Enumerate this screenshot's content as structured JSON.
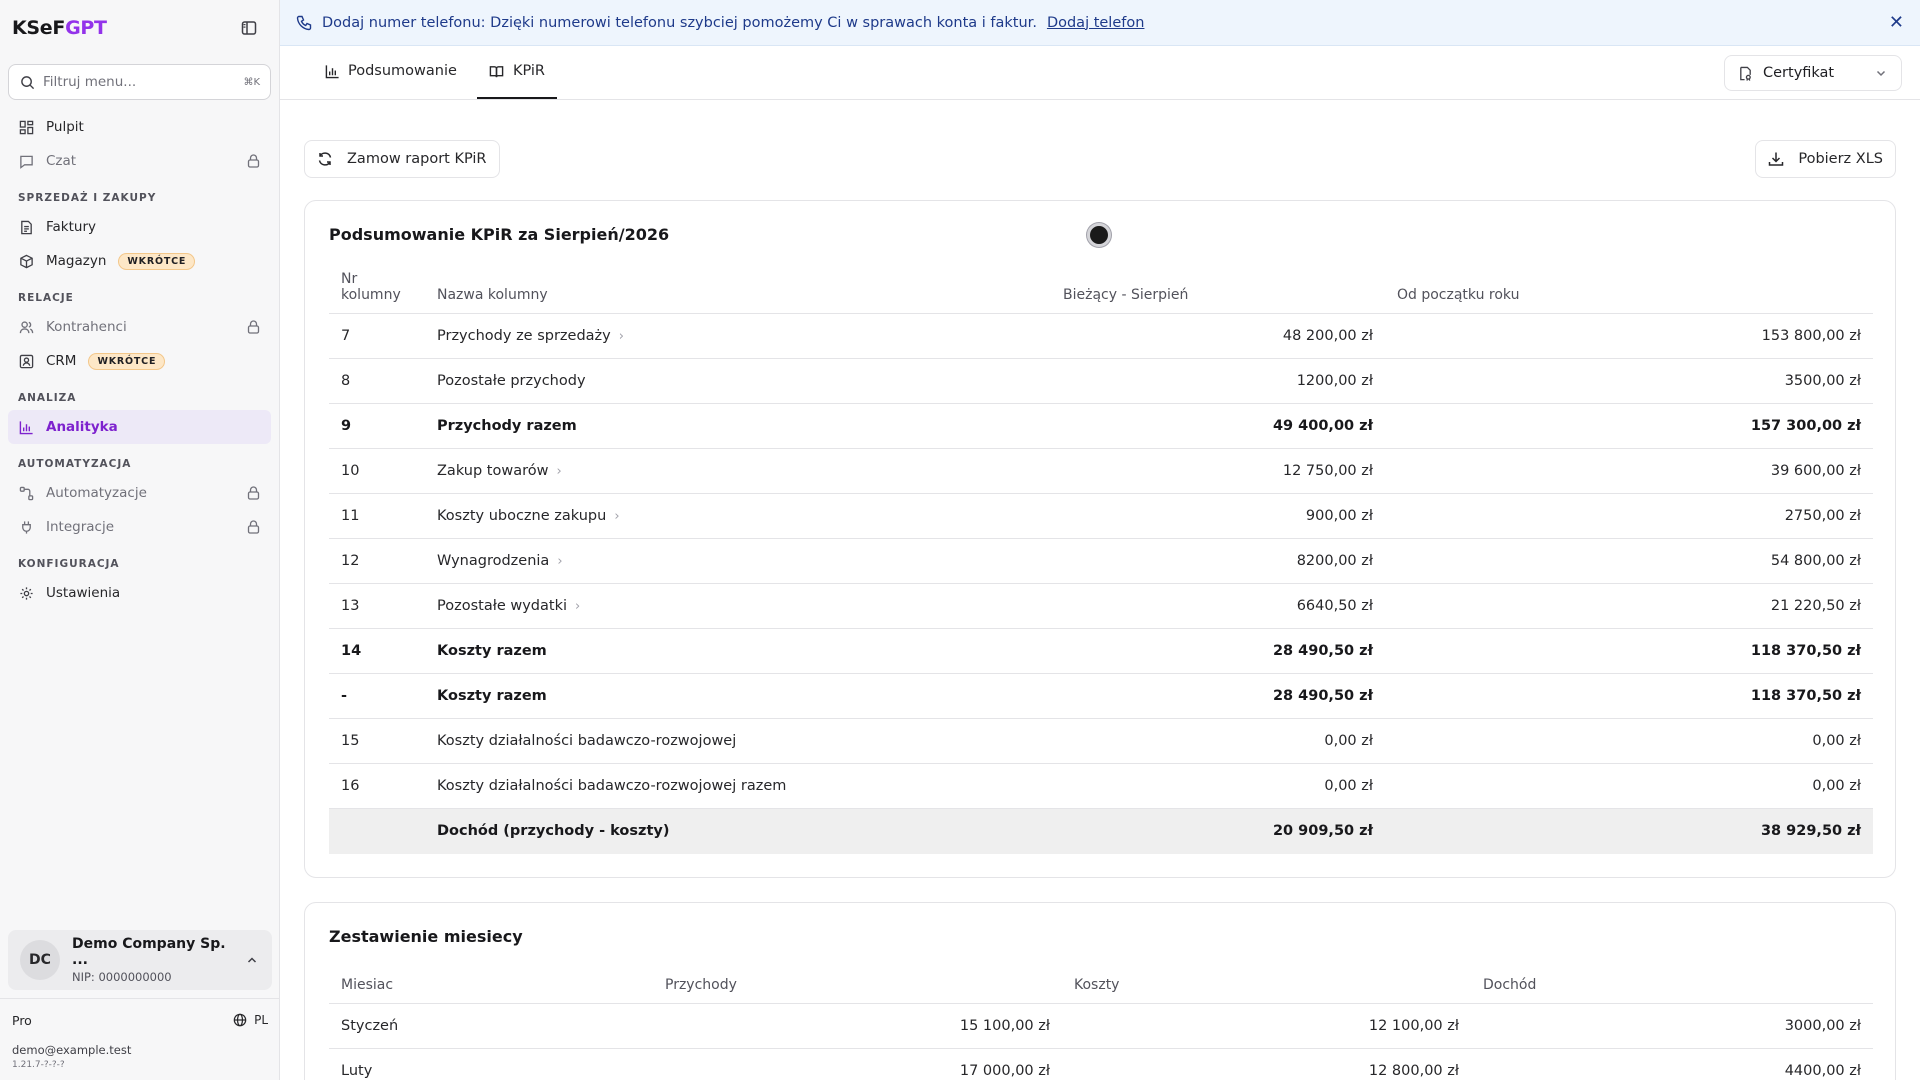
{
  "sidebar": {
    "logo_main": "KSeF",
    "logo_accent": "GPT",
    "search": {
      "placeholder": "Filtruj menu...",
      "shortcut": "⌘K"
    },
    "items_top": [
      {
        "label": "Pulpit",
        "icon": "dashboard-icon"
      },
      {
        "label": "Czat",
        "icon": "chat-icon",
        "locked": true
      }
    ],
    "sections": [
      {
        "title": "SPRZEDAŻ I ZAKUPY",
        "items": [
          {
            "label": "Faktury",
            "icon": "invoice-icon"
          },
          {
            "label": "Magazyn",
            "icon": "box-icon",
            "badge": "WKRÓTCE"
          }
        ]
      },
      {
        "title": "RELACJE",
        "items": [
          {
            "label": "Kontrahenci",
            "icon": "users-icon",
            "locked": true
          },
          {
            "label": "CRM",
            "icon": "contact-icon",
            "badge": "WKRÓTCE"
          }
        ]
      },
      {
        "title": "ANALIZA",
        "items": [
          {
            "label": "Analityka",
            "icon": "chart-icon",
            "active": true
          }
        ]
      },
      {
        "title": "AUTOMATYZACJA",
        "items": [
          {
            "label": "Automatyzacje",
            "icon": "workflow-icon",
            "locked": true
          },
          {
            "label": "Integracje",
            "icon": "plug-icon",
            "locked": true
          }
        ]
      },
      {
        "title": "KONFIGURACJA",
        "items": [
          {
            "label": "Ustawienia",
            "icon": "gear-icon"
          }
        ]
      }
    ],
    "company": {
      "initials": "DC",
      "name": "Demo Company Sp. ...",
      "nip": "NIP: 0000000000"
    },
    "plan": "Pro",
    "language": "PL",
    "email": "demo@example.test",
    "version": "1.21.7-?-?-?"
  },
  "banner": {
    "message": "Dodaj numer telefonu: Dzięki numerowi telefonu szybciej pomożemy Ci w sprawach konta i faktur.",
    "link": "Dodaj telefon"
  },
  "tabs": [
    {
      "label": "Podsumowanie",
      "active": false
    },
    {
      "label": "KPiR",
      "active": true
    }
  ],
  "certificate_select": "Certyfikat",
  "actions": {
    "order_report": "Zamow raport KPiR",
    "download_xls": "Pobierz XLS"
  },
  "summary": {
    "title": "Podsumowanie KPiR za Sierpień/2026",
    "headers": {
      "nr": "Nr kolumny",
      "name": "Nazwa kolumny",
      "current": "Bieżący - Sierpień",
      "ytd": "Od początku roku"
    },
    "rows": [
      {
        "nr": "7",
        "name": "Przychody ze sprzedaży",
        "current": "48 200,00 zł",
        "ytd": "153 800,00 zł",
        "expandable": true,
        "bold": false
      },
      {
        "nr": "8",
        "name": "Pozostałe przychody",
        "current": "1200,00 zł",
        "ytd": "3500,00 zł",
        "expandable": false,
        "bold": false
      },
      {
        "nr": "9",
        "name": "Przychody razem",
        "current": "49 400,00 zł",
        "ytd": "157 300,00 zł",
        "expandable": false,
        "bold": true
      },
      {
        "nr": "10",
        "name": "Zakup towarów",
        "current": "12 750,00 zł",
        "ytd": "39 600,00 zł",
        "expandable": true,
        "bold": false
      },
      {
        "nr": "11",
        "name": "Koszty uboczne zakupu",
        "current": "900,00 zł",
        "ytd": "2750,00 zł",
        "expandable": true,
        "bold": false
      },
      {
        "nr": "12",
        "name": "Wynagrodzenia",
        "current": "8200,00 zł",
        "ytd": "54 800,00 zł",
        "expandable": true,
        "bold": false
      },
      {
        "nr": "13",
        "name": "Pozostałe wydatki",
        "current": "6640,50 zł",
        "ytd": "21 220,50 zł",
        "expandable": true,
        "bold": false
      },
      {
        "nr": "14",
        "name": "Koszty razem",
        "current": "28 490,50 zł",
        "ytd": "118 370,50 zł",
        "expandable": false,
        "bold": true
      },
      {
        "nr": "-",
        "name": "Koszty razem",
        "current": "28 490,50 zł",
        "ytd": "118 370,50 zł",
        "expandable": false,
        "bold": true
      },
      {
        "nr": "15",
        "name": "Koszty działalności badawczo-rozwojowej",
        "current": "0,00 zł",
        "ytd": "0,00 zł",
        "expandable": false,
        "bold": false
      },
      {
        "nr": "16",
        "name": "Koszty działalności badawczo-rozwojowej razem",
        "current": "0,00 zł",
        "ytd": "0,00 zł",
        "expandable": false,
        "bold": false
      }
    ],
    "total": {
      "nr": "",
      "name": "Dochód (przychody - koszty)",
      "current": "20 909,50 zł",
      "ytd": "38 929,50 zł"
    }
  },
  "monthly": {
    "title": "Zestawienie miesiecy",
    "headers": {
      "month": "Miesiac",
      "income": "Przychody",
      "costs": "Koszty",
      "profit": "Dochód"
    },
    "rows": [
      {
        "month": "Styczeń",
        "income": "15 100,00 zł",
        "costs": "12 100,00 zł",
        "profit": "3000,00 zł"
      },
      {
        "month": "Luty",
        "income": "17 000,00 zł",
        "costs": "12 800,00 zł",
        "profit": "4400,00 zł"
      }
    ]
  }
}
